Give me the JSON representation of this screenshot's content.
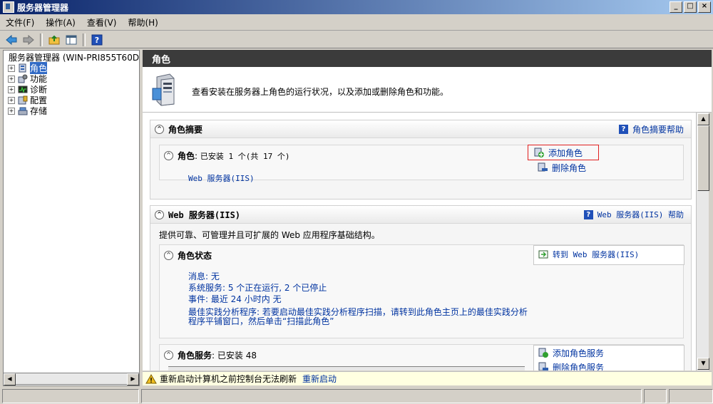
{
  "window": {
    "title": "服务器管理器",
    "controls": [
      "_",
      "□",
      "×"
    ]
  },
  "menu": [
    "文件(F)",
    "操作(A)",
    "查看(V)",
    "帮助(H)"
  ],
  "toolbar": {
    "icons": [
      "back-arrow-icon",
      "forward-arrow-icon",
      "up-folder-icon",
      "show-hide-tree-icon",
      "help-icon"
    ]
  },
  "tree": {
    "root": "服务器管理器 (WIN-PRI855T60D",
    "items": [
      {
        "label": "角色",
        "icon": "roles-icon",
        "selected": true
      },
      {
        "label": "功能",
        "icon": "features-icon",
        "selected": false
      },
      {
        "label": "诊断",
        "icon": "diagnostics-icon",
        "selected": false
      },
      {
        "label": "配置",
        "icon": "configuration-icon",
        "selected": false
      },
      {
        "label": "存储",
        "icon": "storage-icon",
        "selected": false
      }
    ]
  },
  "pane": {
    "title": "角色",
    "banner_text": "查看安装在服务器上角色的运行状况，以及添加或删除角色和功能。"
  },
  "roles_summary": {
    "title": "角色摘要",
    "help": "角色摘要帮助",
    "roles_label": "角色",
    "roles_count": "已安装 1 个(共 17 个)",
    "installed": [
      "Web 服务器(IIS)"
    ],
    "actions": [
      "添加角色",
      "删除角色"
    ]
  },
  "web_server": {
    "title": "Web 服务器(IIS)",
    "help": "Web 服务器(IIS) 帮助",
    "description": "提供可靠、可管理并且可扩展的 Web 应用程序基础结构。",
    "status_title": "角色状态",
    "status_action": "转到 Web 服务器(IIS)",
    "status_lines": [
      "消息: 无",
      "系统服务: 5 个正在运行, 2 个已停止",
      "事件: 最近 24 小时内 无",
      "最佳实践分析程序: 若要启动最佳实践分析程序扫描，请转到此角色主页上的最佳实践分析",
      "程序平铺窗口，然后单击“扫描此角色”"
    ],
    "services_title": "角色服务",
    "services_count": "已安装 48",
    "services_actions": [
      "添加角色服务",
      "删除角色服务"
    ]
  },
  "warning": {
    "text": "重新启动计算机之前控制台无法刷新",
    "link": "重新启动"
  },
  "colors": {
    "link": "#0033a0",
    "header_bg": "#3b3b3b",
    "highlight_box": "#e02020"
  }
}
